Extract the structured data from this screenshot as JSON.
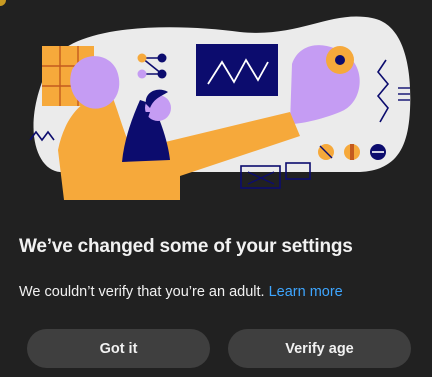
{
  "dialog": {
    "title": "We’ve changed some of your settings",
    "message": "We couldn’t verify that you’re an adult.",
    "learn_more_label": "Learn more",
    "got_it_label": "Got it",
    "verify_age_label": "Verify age"
  },
  "colors": {
    "background": "#212121",
    "button": "#3f3f3f",
    "link": "#3ea6ff",
    "illustration_orange": "#f6a93b",
    "illustration_purple": "#c59cf3",
    "illustration_navy": "#0c0c6e"
  },
  "illustration": "person-with-charts-illustration"
}
